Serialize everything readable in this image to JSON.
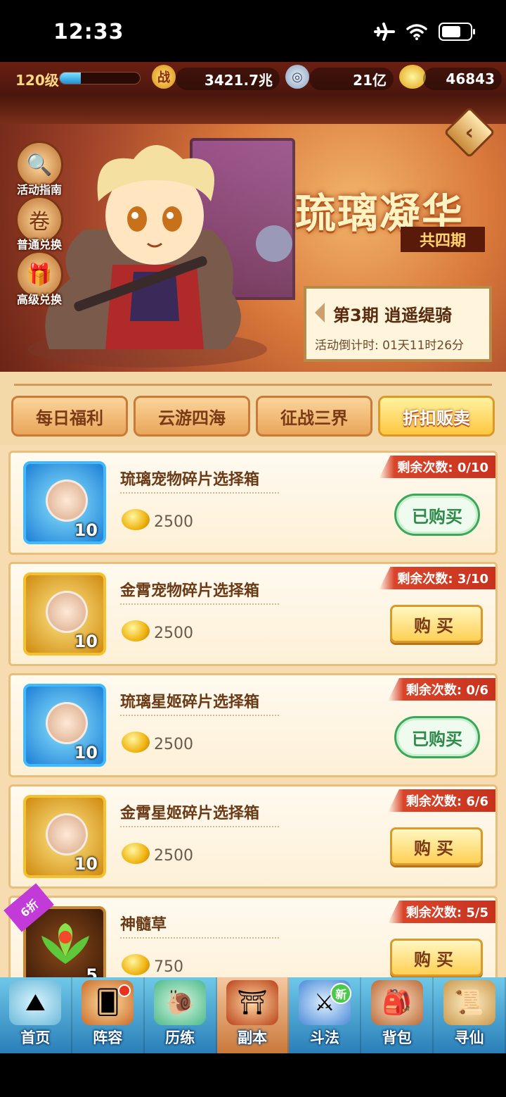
{
  "status": {
    "time": "12:33"
  },
  "resources": {
    "level": "120级",
    "xp_fraction": 0.26,
    "power_badge": "战",
    "power": "3421.7兆",
    "silver": "21亿",
    "gold": "46843"
  },
  "side_buttons": [
    {
      "label": "活动指南",
      "icon": "magnifier-icon"
    },
    {
      "label": "普通兑换",
      "icon": "scroll-icon"
    },
    {
      "label": "高级兑换",
      "icon": "gift-icon"
    }
  ],
  "event": {
    "title": "琉璃凝华",
    "subtitle": "共四期",
    "period": "第3期  逍遥缇骑",
    "countdown": "活动倒计时: 01天11时26分"
  },
  "tabs": [
    {
      "label": "每日福利",
      "active": false
    },
    {
      "label": "云游四海",
      "active": false
    },
    {
      "label": "征战三界",
      "active": false
    },
    {
      "label": "折扣贩卖",
      "active": true
    }
  ],
  "items": [
    {
      "name": "琉璃宠物碎片选择箱",
      "price": "2500",
      "qty": "10",
      "remaining": "剩余次数: 0/10",
      "button": "已购买",
      "bought": true,
      "style": "blue"
    },
    {
      "name": "金霄宠物碎片选择箱",
      "price": "2500",
      "qty": "10",
      "remaining": "剩余次数: 3/10",
      "button": "购买",
      "bought": false,
      "style": "gold"
    },
    {
      "name": "琉璃星姬碎片选择箱",
      "price": "2500",
      "qty": "10",
      "remaining": "剩余次数: 0/6",
      "button": "已购买",
      "bought": true,
      "style": "blue"
    },
    {
      "name": "金霄星姬碎片选择箱",
      "price": "2500",
      "qty": "10",
      "remaining": "剩余次数: 6/6",
      "button": "购买",
      "bought": false,
      "style": "gold"
    },
    {
      "name": "神髓草",
      "price": "750",
      "qty": "5",
      "remaining": "剩余次数: 5/5",
      "button": "购买",
      "bought": false,
      "style": "brown",
      "discount": "6折"
    }
  ],
  "nav": [
    {
      "label": "首页",
      "icon": "home-island-icon"
    },
    {
      "label": "阵容",
      "icon": "cards-icon",
      "dot": true
    },
    {
      "label": "历练",
      "icon": "snail-icon"
    },
    {
      "label": "副本",
      "icon": "temple-gate-icon",
      "center": true
    },
    {
      "label": "斗法",
      "icon": "crossed-swords-icon",
      "badge": "新"
    },
    {
      "label": "背包",
      "icon": "bag-icon"
    },
    {
      "label": "寻仙",
      "icon": "scroll-map-icon"
    }
  ]
}
